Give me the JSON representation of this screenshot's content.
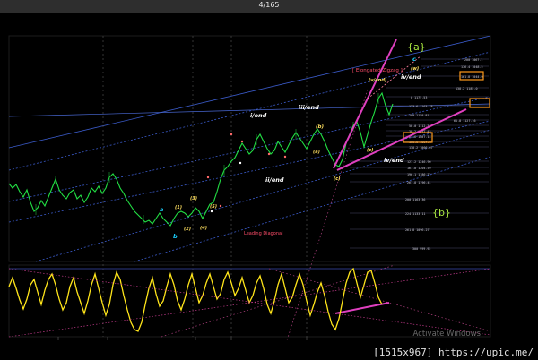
{
  "viewer": {
    "counter": "4/165"
  },
  "footer": {
    "dimensions": "[1515x967]",
    "site": "https://upic.me/",
    "watermark": "Activate Windows"
  },
  "chart": {
    "labels": {
      "bigA": "{a}",
      "bigB": "{b}",
      "elongated": "[ Elongated Zigzag ]",
      "wave_c_top": "c",
      "wave_w_top": "(w)",
      "iv_end_top": "iv/end",
      "v_end": "(v/end)",
      "iv_end_mid": "iv/end",
      "i_end": "i/end",
      "iii_end": "iii/end",
      "ii_end": "ii/end",
      "b_paren": "(b)",
      "a_paren": "(a)",
      "c_paren": "(c)",
      "c_paren2": "(c)",
      "one": "(1)",
      "two": "(2)",
      "three": "(3)",
      "four": "(4)",
      "five": "(5)",
      "a_small": "a",
      "b_small": "b",
      "leading": "Leading Diagonal"
    },
    "fib_labels": [
      "200  1067.1",
      "176.4  1048.5",
      "161.8  1044.0",
      "138.2  1185.0",
      "0  1175.53",
      "123.6  1163.78",
      "100  1150.81",
      "61.8  1127.16",
      "50.0  1112.3",
      "38.2  1097.45",
      "23.6  1087.14",
      "100.0  1084.8",
      "138.2  1066.07",
      "127.2  1246.90",
      "161.8  1204.59",
      "196.1  1186.71",
      "261.8  1196.41",
      "200  1163.36",
      "224  1133.11",
      "261.8  1096.27",
      "300  999.92"
    ],
    "colors": {
      "price": "#22e044",
      "oscillator": "#ffe51a",
      "magenta": "#e040c0",
      "orange": "#ff9a1a",
      "blue": "#3a5ac8"
    }
  }
}
